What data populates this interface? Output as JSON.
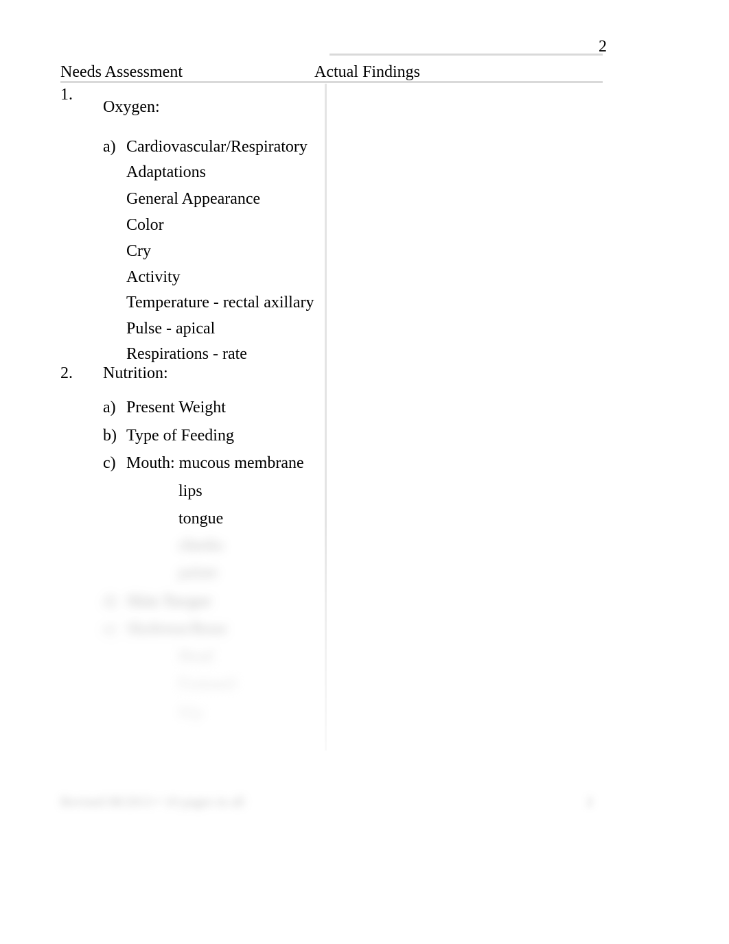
{
  "page_number": "2",
  "headers": {
    "left": "Needs Assessment",
    "right": "Actual Findings"
  },
  "sections": [
    {
      "num": "1.",
      "title": "Oxygen:",
      "subs": [
        {
          "letter": "a)",
          "lines": [
            "Cardiovascular/Respiratory",
            "Adaptations",
            "General Appearance",
            "Color",
            "Cry",
            "Activity",
            "Temperature - rectal axillary",
            "Pulse - apical",
            "Respirations - rate"
          ]
        }
      ]
    },
    {
      "num": "2.",
      "title": "Nutrition:",
      "subs": [
        {
          "letter": "a)",
          "lines": [
            "Present Weight"
          ]
        },
        {
          "letter": "b)",
          "lines": [
            "Type of Feeding"
          ]
        },
        {
          "letter": "c)",
          "lines": [
            "Mouth:  mucous  membrane"
          ],
          "sublines": [
            "lips",
            "tongue",
            "cheeks",
            "palate"
          ]
        },
        {
          "letter": "d)",
          "lines": [
            "Skin Turgor"
          ],
          "blurred": true
        },
        {
          "letter": "e)",
          "lines": [
            "Skeleton/Bone"
          ],
          "sublines": [
            "Head",
            "Fontanel",
            "Hip"
          ],
          "blurred": true
        }
      ]
    }
  ],
  "footer": {
    "left": "Revised 08/2013 • 10 pages in all",
    "right": "2"
  }
}
